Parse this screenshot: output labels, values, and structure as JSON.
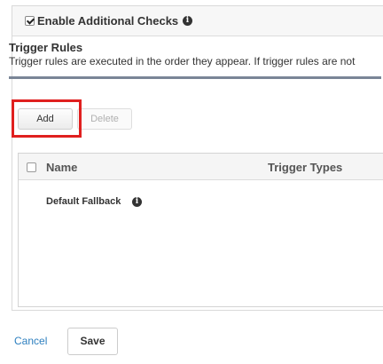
{
  "panel": {
    "header_title": "Enable Additional Checks",
    "header_checked": true
  },
  "section": {
    "title": "Trigger Rules",
    "description": "Trigger rules are executed in the order they appear. If trigger rules are not"
  },
  "toolbar": {
    "add_label": "Add",
    "delete_label": "Delete"
  },
  "table": {
    "columns": [
      "Name",
      "Trigger Types"
    ],
    "rows": [
      {
        "name": "Default Fallback"
      }
    ]
  },
  "footer": {
    "cancel_label": "Cancel",
    "save_label": "Save"
  },
  "icons": {
    "info": "info-circle-icon",
    "checkbox": "checkbox-icon"
  },
  "colors": {
    "highlight": "#e0201f",
    "link": "#2d7fbf",
    "rule": "#7a8597"
  }
}
